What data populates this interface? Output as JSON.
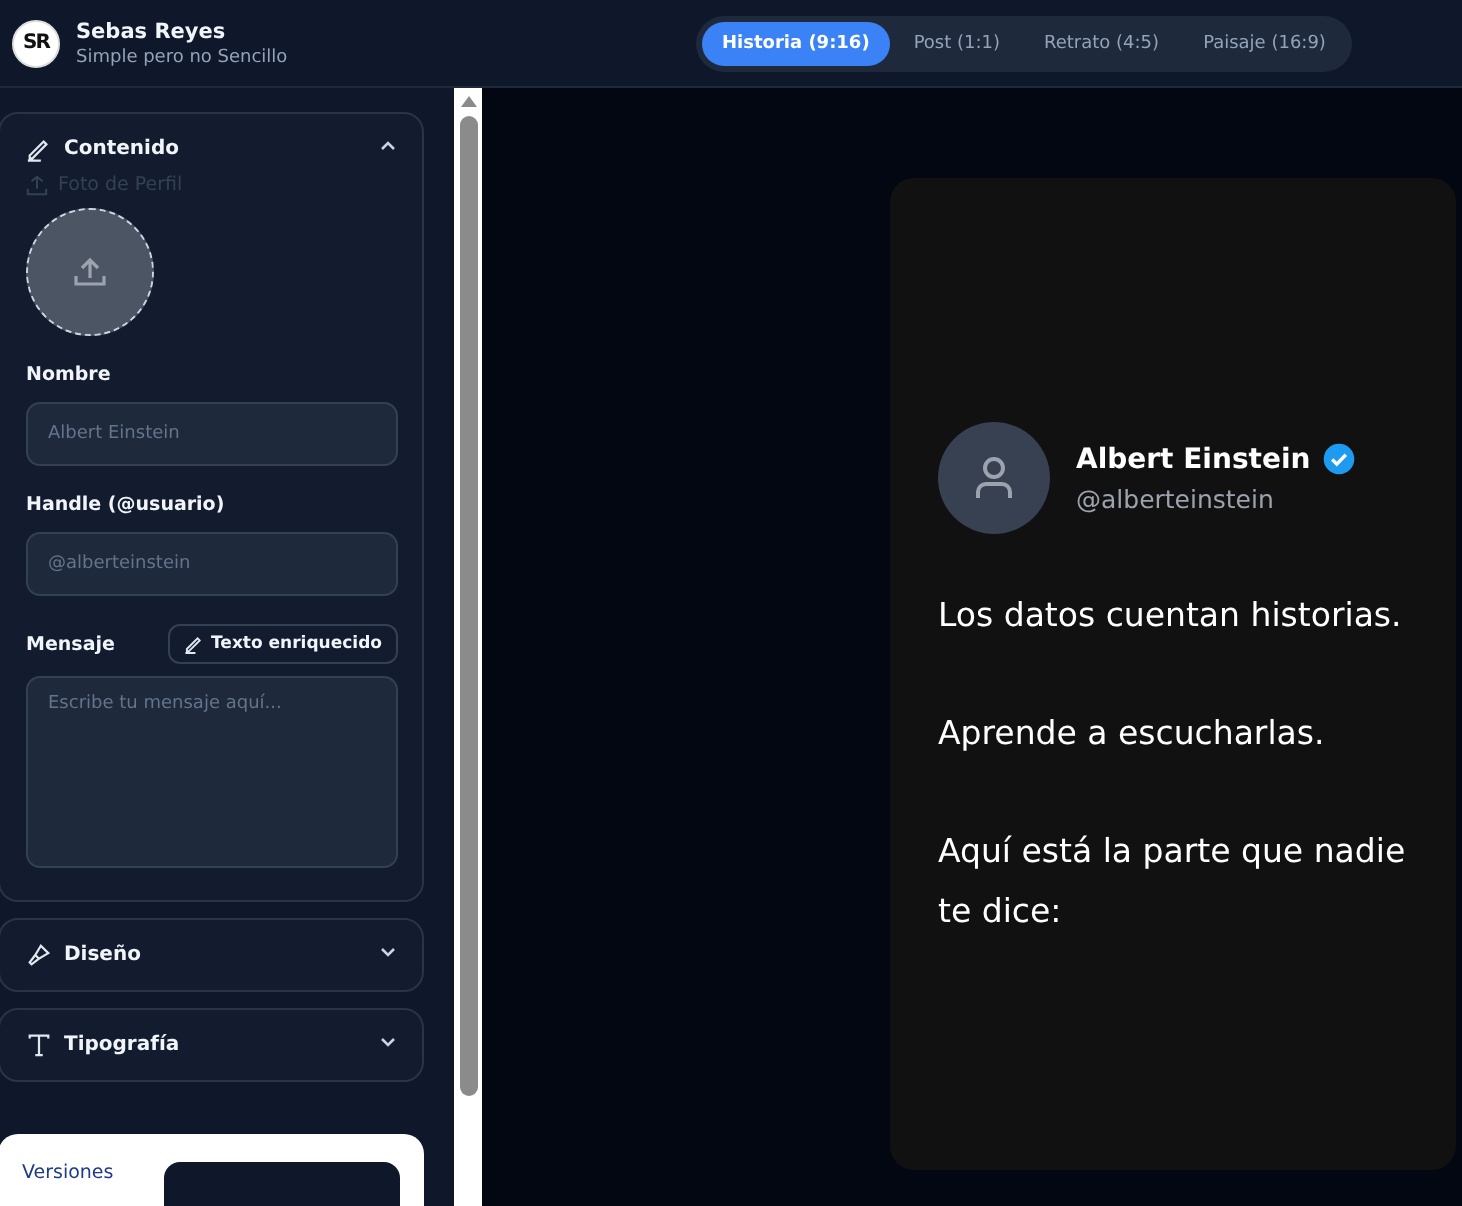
{
  "header": {
    "logo": "SR",
    "title": "Sebas Reyes",
    "subtitle": "Simple pero no Sencillo"
  },
  "tabs": [
    {
      "label": "Historia (9:16)",
      "selected": true
    },
    {
      "label": "Post (1:1)",
      "selected": false
    },
    {
      "label": "Retrato (4:5)",
      "selected": false
    },
    {
      "label": "Paisaje (16:9)",
      "selected": false
    }
  ],
  "sidebar": {
    "sections": [
      {
        "kind": "content",
        "title": "Contenido",
        "expanded": true,
        "photo_label": "Foto de Perfil",
        "fields": [
          {
            "label": "Nombre",
            "placeholder": "Albert Einstein"
          },
          {
            "label": "Handle (@usuario)",
            "placeholder": "@alberteinstein"
          }
        ],
        "message": {
          "label": "Mensaje",
          "button": "Texto enriquecido",
          "placeholder": "Escribe tu mensaje aquí..."
        }
      },
      {
        "kind": "design",
        "title": "Diseño",
        "expanded": false
      },
      {
        "kind": "typography",
        "title": "Tipografía",
        "expanded": false
      }
    ],
    "versions": {
      "label": "Versiones"
    }
  },
  "preview": {
    "name": "Albert Einstein",
    "verified": true,
    "handle": "@alberteinstein",
    "paragraphs": [
      "Los datos cuentan historias.",
      "Aprende a escucharlas.",
      "Aquí está la parte que nadie te dice:"
    ]
  }
}
